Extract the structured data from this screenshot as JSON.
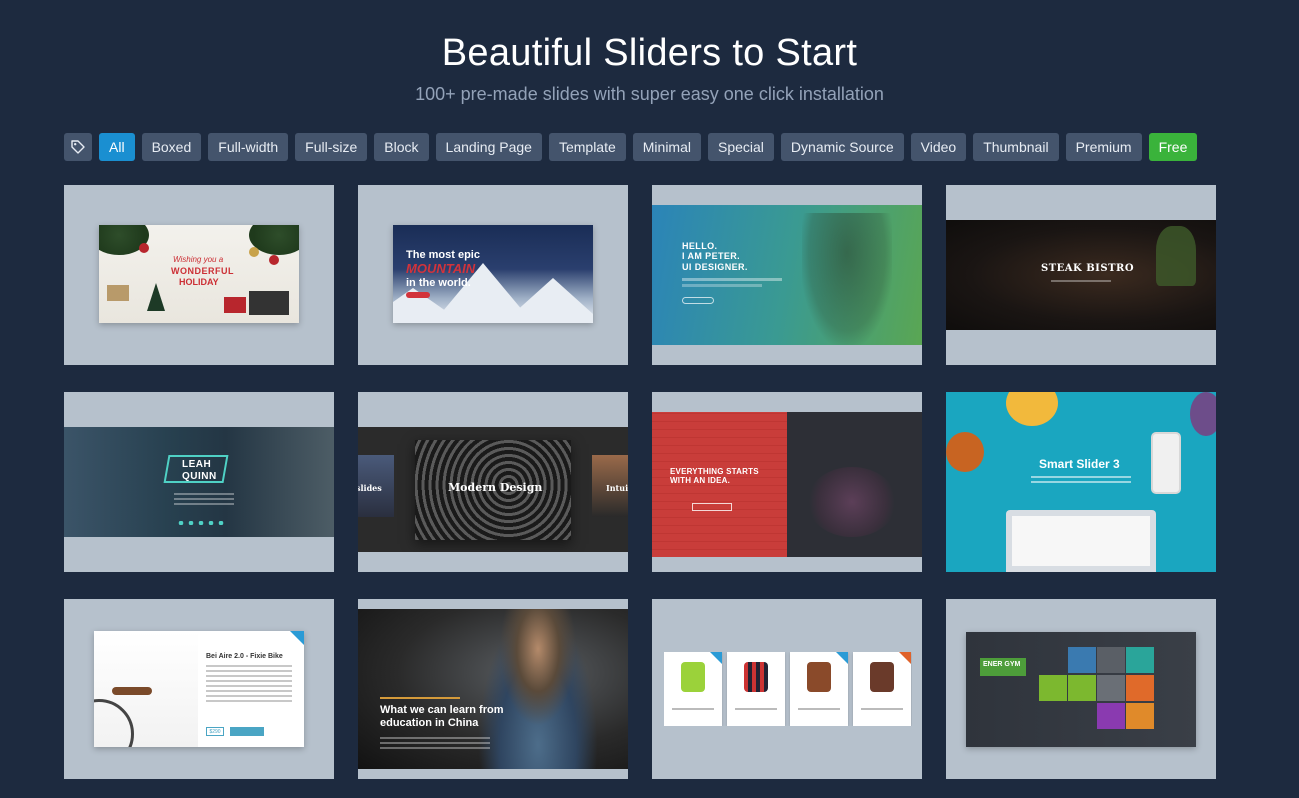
{
  "header": {
    "title": "Beautiful Sliders to Start",
    "subtitle": "100+ pre-made slides with super easy one click installation"
  },
  "filters": {
    "tag_icon": "tag-icon",
    "items": [
      {
        "label": "All",
        "state": "active"
      },
      {
        "label": "Boxed"
      },
      {
        "label": "Full-width"
      },
      {
        "label": "Full-size"
      },
      {
        "label": "Block"
      },
      {
        "label": "Landing Page"
      },
      {
        "label": "Template"
      },
      {
        "label": "Minimal"
      },
      {
        "label": "Special"
      },
      {
        "label": "Dynamic Source"
      },
      {
        "label": "Video"
      },
      {
        "label": "Thumbnail"
      },
      {
        "label": "Premium"
      },
      {
        "label": "Free",
        "state": "free"
      }
    ]
  },
  "colors": {
    "background": "#1d2a3f",
    "filter_default": "#44546c",
    "filter_active": "#1a8fd1",
    "filter_free": "#3ab33b",
    "card": "#b6c1cc"
  },
  "cards": [
    {
      "id": "holiday",
      "lines": [
        "Wishing you a",
        "WONDERFUL",
        "HOLIDAY"
      ]
    },
    {
      "id": "mountain",
      "lines": [
        "The most epic",
        "MOUNTAIN",
        "in the world."
      ]
    },
    {
      "id": "peter",
      "lines": [
        "HELLO.\nI AM PETER.\nUI DESIGNER."
      ]
    },
    {
      "id": "steak",
      "lines": [
        "STEAK BISTRO"
      ]
    },
    {
      "id": "leah",
      "lines": [
        "LEAH\nQUINN"
      ]
    },
    {
      "id": "modern",
      "lines": [
        "Modern Design",
        "slides",
        "Intui"
      ]
    },
    {
      "id": "everything",
      "lines": [
        "EVERYTHING STARTS\nWITH AN IDEA."
      ]
    },
    {
      "id": "smartslider",
      "lines": [
        "Smart Slider 3"
      ]
    },
    {
      "id": "bike",
      "lines": [
        "Bei Aire 2.0 - Fixie Bike",
        "$290"
      ]
    },
    {
      "id": "education",
      "lines": [
        "What we can learn from\neducation in China"
      ]
    },
    {
      "id": "watches",
      "lines": []
    },
    {
      "id": "gym",
      "lines": [
        "ENER GYM"
      ]
    }
  ]
}
